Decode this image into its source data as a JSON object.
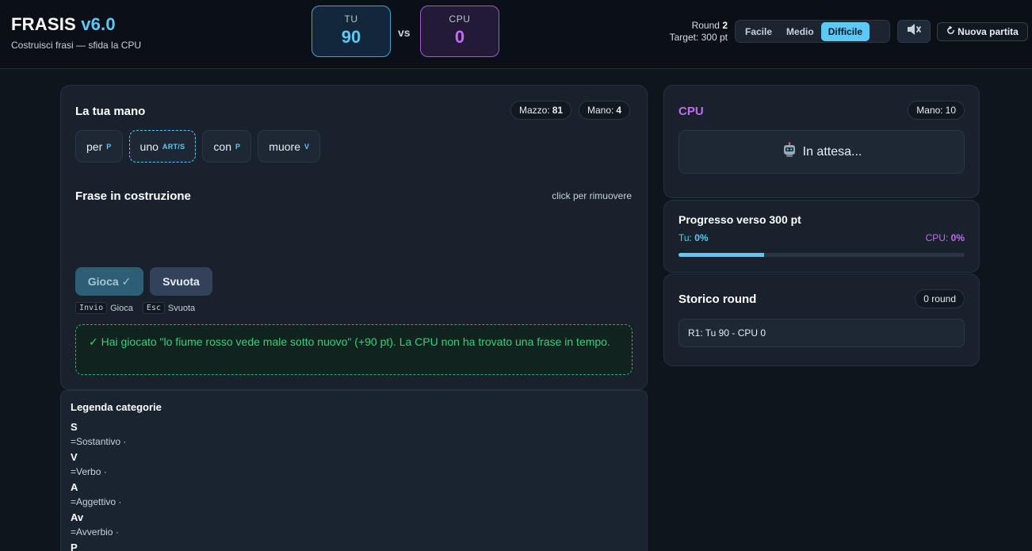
{
  "header": {
    "brand": "FRASIS",
    "version": "v6.0",
    "subtitle": "Costruisci frasi — sfida la CPU",
    "score_you_label": "TU",
    "score_you_value": "90",
    "vs": "vs",
    "score_cpu_label": "CPU",
    "score_cpu_value": "0",
    "round_label": "Round",
    "round_value": "2",
    "target": "Target: 300 pt",
    "difficulty": [
      "Facile",
      "Medio",
      "Difficile"
    ],
    "difficulty_selected": "Difficile",
    "new_game": "Nuova partita",
    "icons": {
      "sound": "speaker-muted-icon",
      "refresh": "refresh-icon"
    }
  },
  "hand_panel": {
    "title": "La tua mano",
    "deck_label": "Mazzo:",
    "deck_count": "81",
    "hand_label": "Mano:",
    "hand_count": "4",
    "cards": [
      {
        "word": "per",
        "category": "P"
      },
      {
        "word": "uno",
        "category": "ART/S"
      },
      {
        "word": "con",
        "category": "P"
      },
      {
        "word": "muore",
        "category": "V"
      }
    ],
    "sentence_title": "Frase in costruzione",
    "sentence_hint": "click per rimuovere",
    "play_label": "Gioca ✓",
    "clear_label": "Svuota",
    "shortcut_play_key": "Invio",
    "shortcut_play": "Gioca",
    "shortcut_clear_key": "Esc",
    "shortcut_clear": "Svuota",
    "message": "✓ Hai giocato \"lo fiume rosso vede male sotto nuovo\" (+90 pt). La CPU non ha trovato una frase in tempo."
  },
  "legend": {
    "title": "Legenda categorie",
    "items": [
      {
        "abbr": "S",
        "desc": "=Sostantivo ·"
      },
      {
        "abbr": "V",
        "desc": "=Verbo ·"
      },
      {
        "abbr": "A",
        "desc": "=Aggettivo ·"
      },
      {
        "abbr": "Av",
        "desc": "=Avverbio ·"
      },
      {
        "abbr": "P",
        "desc": ""
      }
    ]
  },
  "cpu_panel": {
    "title": "CPU",
    "hand_label": "Mano:",
    "hand_count": "10",
    "status_icon": "robot-icon",
    "status": "In attesa..."
  },
  "progress_panel": {
    "title": "Progresso verso 300 pt",
    "you_label": "Tu:",
    "you_value": "0%",
    "cpu_label": "CPU:",
    "cpu_value": "0%",
    "bar_fill_fraction": 0.3
  },
  "history_panel": {
    "title": "Storico round",
    "count": "0 round",
    "rows": [
      "R1: Tu 90 - CPU 0"
    ]
  },
  "colors": {
    "accent_you": "#5cc8f5",
    "accent_cpu": "#c46af5",
    "success": "#34d27a"
  }
}
